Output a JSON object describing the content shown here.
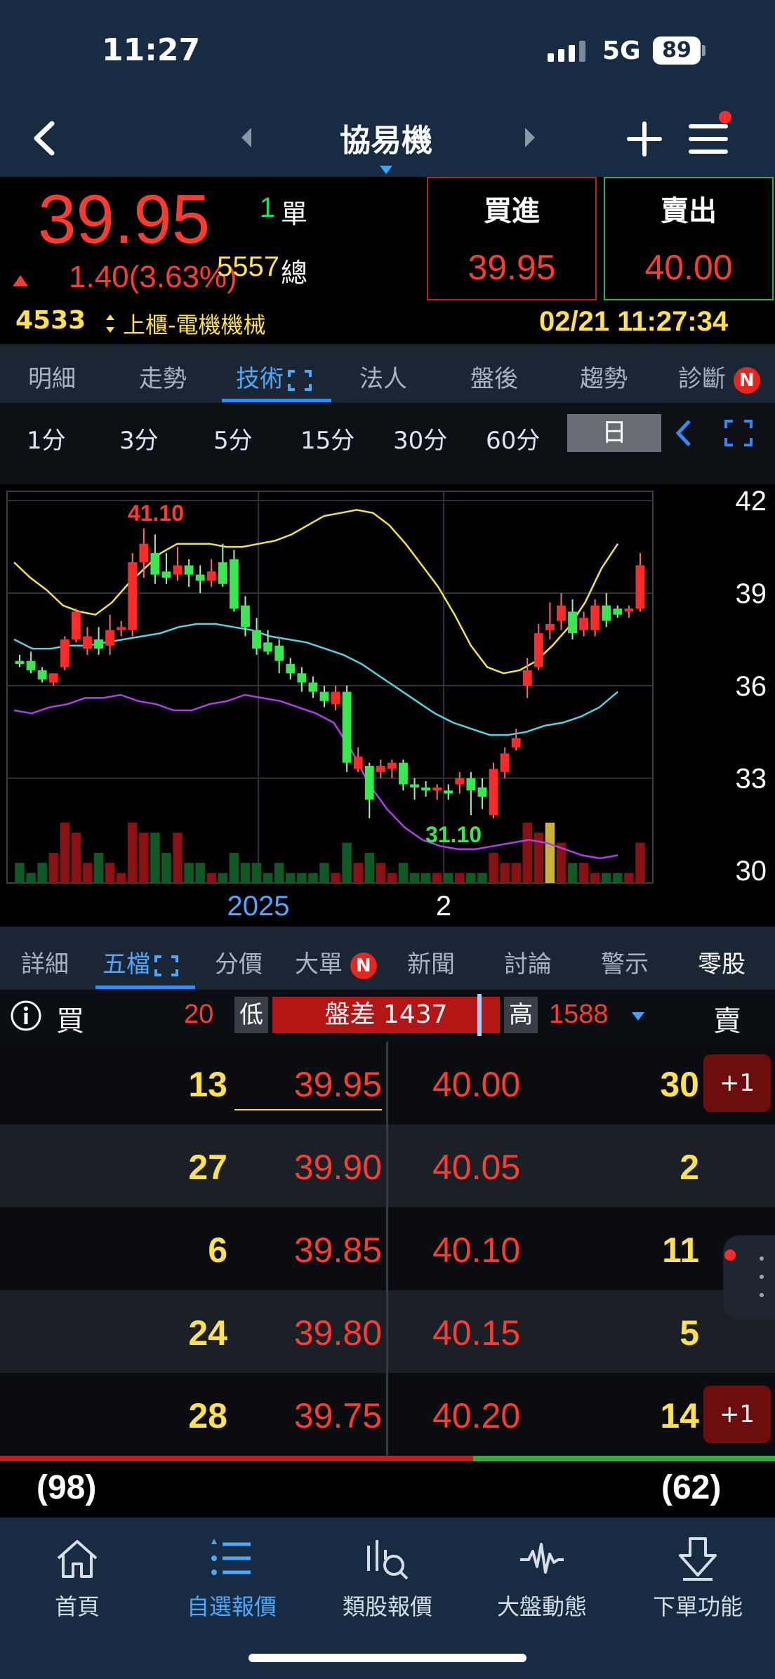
{
  "status": {
    "time": "11:27",
    "network": "5G",
    "battery": "89"
  },
  "header": {
    "title": "協易機"
  },
  "quote": {
    "price": "39.95",
    "change": "1.40(3.63%)",
    "single_label": "單",
    "single_value": "1",
    "total_label": "總",
    "total_value": "5557",
    "buy_label": "買進",
    "buy_price": "39.95",
    "sell_label": "賣出",
    "sell_price": "40.00",
    "code": "4533",
    "category": "上櫃-電機機械",
    "datetime": "02/21 11:27:34"
  },
  "tabs": [
    "明細",
    "走勢",
    "技術",
    "法人",
    "盤後",
    "趨勢",
    "診斷"
  ],
  "badge_n": "N",
  "periods": [
    "1分",
    "3分",
    "5分",
    "15分",
    "30分",
    "60分",
    "日"
  ],
  "chart_data": {
    "type": "candlestick",
    "y_ticks": [
      "42",
      "39",
      "36",
      "33",
      "30"
    ],
    "x_labels": [
      "2025",
      "2"
    ],
    "ylim": [
      29.6,
      42.3
    ],
    "annotations": {
      "high": "41.10",
      "low": "31.10"
    },
    "candles": [
      {
        "o": 36.8,
        "h": 37.0,
        "l": 36.6,
        "c": 36.7
      },
      {
        "o": 36.8,
        "h": 37.1,
        "l": 36.4,
        "c": 36.5
      },
      {
        "o": 36.5,
        "h": 36.6,
        "l": 36.1,
        "c": 36.2
      },
      {
        "o": 36.1,
        "h": 36.4,
        "l": 36.0,
        "c": 36.4
      },
      {
        "o": 36.6,
        "h": 37.6,
        "l": 36.5,
        "c": 37.5
      },
      {
        "o": 37.5,
        "h": 38.5,
        "l": 37.4,
        "c": 38.4
      },
      {
        "o": 37.2,
        "h": 37.9,
        "l": 37.0,
        "c": 37.6
      },
      {
        "o": 37.5,
        "h": 37.9,
        "l": 37.0,
        "c": 37.2
      },
      {
        "o": 37.3,
        "h": 38.3,
        "l": 37.0,
        "c": 37.8
      },
      {
        "o": 37.8,
        "h": 38.1,
        "l": 37.6,
        "c": 37.9
      },
      {
        "o": 37.8,
        "h": 40.3,
        "l": 37.6,
        "c": 40.0
      },
      {
        "o": 40.0,
        "h": 41.1,
        "l": 39.5,
        "c": 40.6
      },
      {
        "o": 40.3,
        "h": 40.9,
        "l": 39.3,
        "c": 39.6
      },
      {
        "o": 39.7,
        "h": 40.3,
        "l": 39.3,
        "c": 39.5
      },
      {
        "o": 39.6,
        "h": 40.5,
        "l": 39.4,
        "c": 39.9
      },
      {
        "o": 39.9,
        "h": 40.1,
        "l": 39.2,
        "c": 39.6
      },
      {
        "o": 39.6,
        "h": 39.9,
        "l": 39.0,
        "c": 39.4
      },
      {
        "o": 39.4,
        "h": 40.1,
        "l": 39.2,
        "c": 39.7
      },
      {
        "o": 40.0,
        "h": 40.6,
        "l": 39.2,
        "c": 39.3
      },
      {
        "o": 40.1,
        "h": 40.4,
        "l": 38.4,
        "c": 38.5
      },
      {
        "o": 38.6,
        "h": 38.9,
        "l": 37.6,
        "c": 37.9
      },
      {
        "o": 37.8,
        "h": 38.2,
        "l": 37.0,
        "c": 37.2
      },
      {
        "o": 37.4,
        "h": 37.8,
        "l": 37.0,
        "c": 37.1
      },
      {
        "o": 37.3,
        "h": 37.5,
        "l": 36.4,
        "c": 36.8
      },
      {
        "o": 36.7,
        "h": 36.9,
        "l": 36.2,
        "c": 36.4
      },
      {
        "o": 36.4,
        "h": 36.6,
        "l": 35.8,
        "c": 36.1
      },
      {
        "o": 36.1,
        "h": 36.3,
        "l": 35.6,
        "c": 35.8
      },
      {
        "o": 35.8,
        "h": 36.0,
        "l": 35.3,
        "c": 35.5
      },
      {
        "o": 35.4,
        "h": 36.0,
        "l": 35.2,
        "c": 35.8
      },
      {
        "o": 35.8,
        "h": 36.0,
        "l": 33.2,
        "c": 33.5
      },
      {
        "o": 33.3,
        "h": 34.0,
        "l": 33.2,
        "c": 33.7
      },
      {
        "o": 33.4,
        "h": 33.5,
        "l": 31.7,
        "c": 32.3
      },
      {
        "o": 33.2,
        "h": 33.6,
        "l": 33.0,
        "c": 33.4
      },
      {
        "o": 33.3,
        "h": 33.6,
        "l": 33.0,
        "c": 33.5
      },
      {
        "o": 33.5,
        "h": 33.6,
        "l": 32.6,
        "c": 32.8
      },
      {
        "o": 32.8,
        "h": 33.0,
        "l": 32.3,
        "c": 32.7
      },
      {
        "o": 32.7,
        "h": 32.9,
        "l": 32.4,
        "c": 32.6
      },
      {
        "o": 32.6,
        "h": 32.8,
        "l": 32.3,
        "c": 32.7
      },
      {
        "o": 32.6,
        "h": 32.8,
        "l": 32.3,
        "c": 32.5
      },
      {
        "o": 32.8,
        "h": 33.2,
        "l": 32.5,
        "c": 33.0
      },
      {
        "o": 33.0,
        "h": 33.2,
        "l": 31.8,
        "c": 32.6
      },
      {
        "o": 32.7,
        "h": 33.0,
        "l": 32.0,
        "c": 32.4
      },
      {
        "o": 31.8,
        "h": 33.5,
        "l": 31.7,
        "c": 33.3
      },
      {
        "o": 33.2,
        "h": 34.0,
        "l": 33.0,
        "c": 33.8
      },
      {
        "o": 34.0,
        "h": 34.6,
        "l": 33.9,
        "c": 34.3
      },
      {
        "o": 36.0,
        "h": 36.9,
        "l": 35.6,
        "c": 36.5
      },
      {
        "o": 36.6,
        "h": 38.0,
        "l": 36.5,
        "c": 37.7
      },
      {
        "o": 37.8,
        "h": 38.7,
        "l": 37.5,
        "c": 38.0
      },
      {
        "o": 38.1,
        "h": 39.0,
        "l": 37.8,
        "c": 38.6
      },
      {
        "o": 38.4,
        "h": 38.8,
        "l": 37.5,
        "c": 37.7
      },
      {
        "o": 37.8,
        "h": 38.4,
        "l": 37.6,
        "c": 38.2
      },
      {
        "o": 37.8,
        "h": 38.8,
        "l": 37.6,
        "c": 38.6
      },
      {
        "o": 38.6,
        "h": 39.0,
        "l": 37.9,
        "c": 38.1
      },
      {
        "o": 38.5,
        "h": 38.6,
        "l": 38.2,
        "c": 38.3
      },
      {
        "o": 38.4,
        "h": 38.6,
        "l": 38.2,
        "c": 38.5
      },
      {
        "o": 38.5,
        "h": 40.3,
        "l": 38.4,
        "c": 39.9
      }
    ],
    "series": [
      {
        "color": "#f2e542",
        "values": [
          40.0,
          39.5,
          39.1,
          38.6,
          38.4,
          38.3,
          38.7,
          39.3,
          39.8,
          40.3,
          40.6,
          40.6,
          40.6,
          40.5,
          40.5,
          40.6,
          40.7,
          40.9,
          41.2,
          41.5,
          41.6,
          41.7,
          41.6,
          41.2,
          40.6,
          39.9,
          39.2,
          38.3,
          37.3,
          36.6,
          36.4,
          36.5,
          36.8,
          37.3,
          37.9,
          38.7,
          39.8,
          40.6
        ]
      },
      {
        "color": "#52d3e8",
        "values": [
          37.5,
          37.2,
          37.2,
          37.3,
          37.3,
          37.4,
          37.5,
          37.6,
          37.7,
          37.9,
          38.0,
          38.0,
          37.9,
          37.8,
          37.6,
          37.5,
          37.4,
          37.2,
          37.0,
          36.7,
          36.3,
          35.9,
          35.5,
          35.1,
          34.8,
          34.6,
          34.4,
          34.4,
          34.5,
          34.7,
          34.8,
          35.0,
          35.3,
          35.8
        ]
      },
      {
        "color": "#b43cf0",
        "values": [
          35.2,
          35.1,
          35.3,
          35.4,
          35.6,
          35.6,
          35.7,
          35.5,
          35.4,
          35.2,
          35.2,
          35.4,
          35.5,
          35.7,
          35.6,
          35.5,
          35.3,
          35.1,
          34.8,
          33.9,
          32.8,
          32.0,
          31.4,
          31.0,
          30.8,
          30.7,
          30.7,
          30.8,
          30.9,
          31.0,
          30.9,
          30.7,
          30.5,
          30.4,
          30.5
        ]
      }
    ],
    "volume": [
      2,
      1,
      2,
      3,
      6,
      5,
      2,
      3,
      2,
      1,
      6,
      5,
      5,
      3,
      5,
      2,
      2,
      1,
      1,
      3,
      2,
      2,
      1,
      2,
      1,
      1,
      1,
      2,
      1,
      4,
      2,
      3,
      2,
      1,
      2,
      1,
      1,
      1,
      1,
      1,
      1,
      1,
      3,
      2,
      2,
      6,
      5,
      6,
      4,
      2,
      2,
      1,
      1,
      1,
      1,
      4
    ]
  },
  "subtabs": [
    "詳細",
    "五檔",
    "分價",
    "大單",
    "新聞",
    "討論",
    "警示",
    "零股"
  ],
  "summary": {
    "buy_label": "買",
    "low_value": "20",
    "low_label": "低",
    "diff_text": "盤差 1437",
    "high_label": "高",
    "high_value": "1588",
    "sell_label": "賣"
  },
  "book": [
    {
      "bq": "13",
      "bp": "39.95",
      "ap": "40.00",
      "aq": "30",
      "tag": "+1"
    },
    {
      "bq": "27",
      "bp": "39.90",
      "ap": "40.05",
      "aq": "2",
      "tag": ""
    },
    {
      "bq": "6",
      "bp": "39.85",
      "ap": "40.10",
      "aq": "11",
      "tag": ""
    },
    {
      "bq": "24",
      "bp": "39.80",
      "ap": "40.15",
      "aq": "5",
      "tag": ""
    },
    {
      "bq": "28",
      "bp": "39.75",
      "ap": "40.20",
      "aq": "14",
      "tag": "+1"
    }
  ],
  "totals": {
    "buy": "(98)",
    "sell": "(62)",
    "buy_ratio": 0.61
  },
  "bottom_nav": [
    "首頁",
    "自選報價",
    "類股報價",
    "大盤動態",
    "下單功能"
  ],
  "colors": {
    "up": "#ff3b30",
    "down": "#22e04a",
    "highlight": "#ffe14d",
    "accent": "#4aa8ff"
  }
}
